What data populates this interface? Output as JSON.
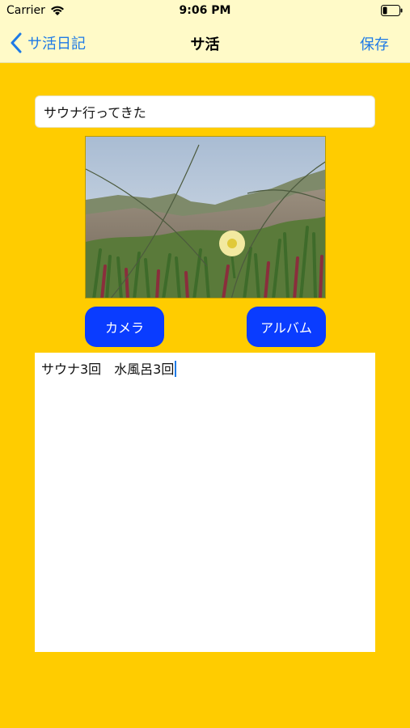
{
  "status_bar": {
    "carrier": "Carrier",
    "time": "9:06 PM",
    "wifi_icon": "wifi-icon",
    "battery_icon": "battery-icon"
  },
  "nav": {
    "back_label": "サ活日記",
    "title": "サ活",
    "save_label": "保存",
    "back_icon": "chevron-left-icon",
    "tint_color": "#1E7AE6",
    "bar_color": "#FFFAC8"
  },
  "form": {
    "title_value": "サウナ行ってきた",
    "photo_icon": "photo-image",
    "camera_button_label": "カメラ",
    "album_button_label": "アルバム",
    "memo_value": "サウナ3回　水風呂3回",
    "button_color": "#0A3CFF"
  },
  "theme": {
    "background": "#FFCC00"
  }
}
